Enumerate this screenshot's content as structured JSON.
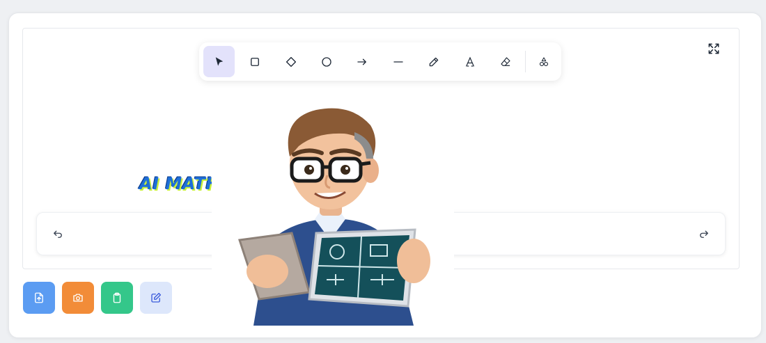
{
  "colors": {
    "active_tool_bg": "#e3e2fb",
    "upload_bg": "#5b9cf2",
    "camera_bg": "#f28c38",
    "clipboard_bg": "#34c78a",
    "edit_bg": "#dde7fb"
  },
  "toolbar": {
    "tools": [
      {
        "id": "select",
        "icon": "pointer-icon",
        "active": true
      },
      {
        "id": "rectangle",
        "icon": "square-icon",
        "active": false
      },
      {
        "id": "diamond",
        "icon": "diamond-icon",
        "active": false
      },
      {
        "id": "ellipse",
        "icon": "circle-icon",
        "active": false
      },
      {
        "id": "arrow",
        "icon": "arrow-right-icon",
        "active": false
      },
      {
        "id": "line",
        "icon": "line-icon",
        "active": false
      },
      {
        "id": "draw",
        "icon": "pencil-icon",
        "active": false
      },
      {
        "id": "text",
        "icon": "text-icon",
        "active": false
      },
      {
        "id": "eraser",
        "icon": "eraser-icon",
        "active": false
      },
      {
        "id": "shapes",
        "icon": "shapes-icon",
        "active": false
      }
    ]
  },
  "canvas": {
    "expand_icon": "expand-icon"
  },
  "history": {
    "undo_icon": "undo-icon",
    "redo_icon": "redo-icon"
  },
  "actions": [
    {
      "id": "upload",
      "icon": "file-upload-icon"
    },
    {
      "id": "camera",
      "icon": "camera-icon"
    },
    {
      "id": "clipboard",
      "icon": "clipboard-icon"
    },
    {
      "id": "edit",
      "icon": "edit-icon"
    }
  ],
  "overlay": {
    "logo_text": "AI MATH TUTOR"
  }
}
